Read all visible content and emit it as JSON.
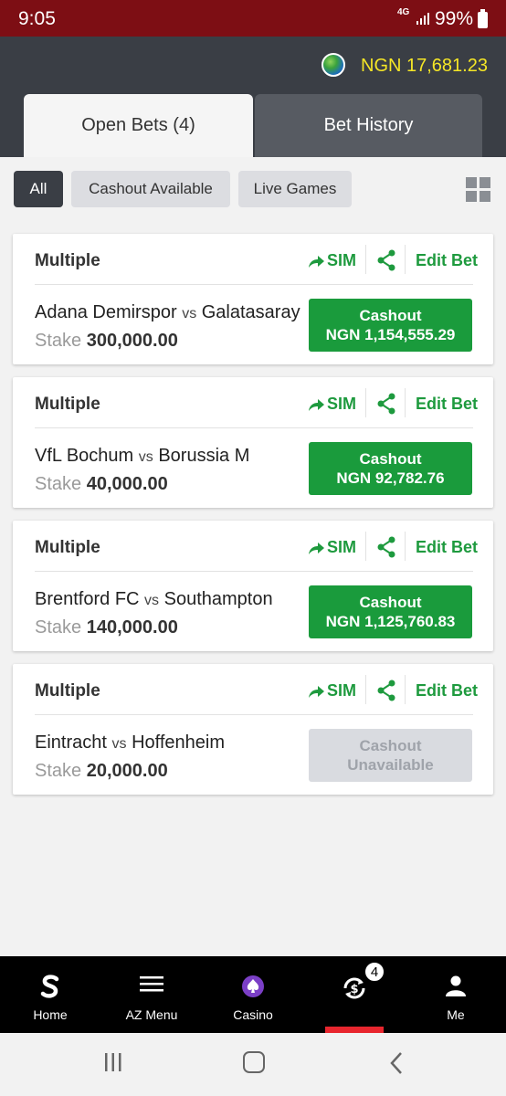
{
  "status_bar": {
    "time": "9:05",
    "network": "4G",
    "battery": "99%"
  },
  "header": {
    "balance": "NGN 17,681.23"
  },
  "tabs": [
    {
      "label": "Open Bets (4)",
      "active": true
    },
    {
      "label": "Bet History",
      "active": false
    }
  ],
  "filters": [
    {
      "label": "All",
      "active": true
    },
    {
      "label": "Cashout Available",
      "active": false
    },
    {
      "label": "Live Games",
      "active": false
    }
  ],
  "bets": [
    {
      "type": "Multiple",
      "sim_label": "SIM",
      "edit_label": "Edit Bet",
      "home": "Adana Demirspor",
      "vs": "vs",
      "away": "Galatasaray",
      "stake_label": "Stake",
      "stake": "300,000.00",
      "cashout_title": "Cashout",
      "cashout_value": "NGN  1,154,555.29",
      "available": true
    },
    {
      "type": "Multiple",
      "sim_label": "SIM",
      "edit_label": "Edit Bet",
      "home": "VfL Bochum",
      "vs": "vs",
      "away": "Borussia M",
      "stake_label": "Stake",
      "stake": "40,000.00",
      "cashout_title": "Cashout",
      "cashout_value": "NGN  92,782.76",
      "available": true
    },
    {
      "type": "Multiple",
      "sim_label": "SIM",
      "edit_label": "Edit Bet",
      "home": "Brentford FC",
      "vs": "vs",
      "away": "Southampton",
      "stake_label": "Stake",
      "stake": "140,000.00",
      "cashout_title": "Cashout",
      "cashout_value": "NGN  1,125,760.83",
      "available": true
    },
    {
      "type": "Multiple",
      "sim_label": "SIM",
      "edit_label": "Edit Bet",
      "home": "Eintracht",
      "vs": "vs",
      "away": "Hoffenheim",
      "stake_label": "Stake",
      "stake": "20,000.00",
      "cashout_title": "Cashout",
      "cashout_value": "Unavailable",
      "available": false
    }
  ],
  "bottom_nav": [
    {
      "label": "Home",
      "icon": "sportybet-logo-icon"
    },
    {
      "label": "AZ Menu",
      "icon": "menu-icon"
    },
    {
      "label": "Casino",
      "icon": "spade-icon"
    },
    {
      "label": "",
      "icon": "cashout-bets-icon",
      "badge": "4",
      "active": true
    },
    {
      "label": "Me",
      "icon": "user-icon"
    }
  ],
  "colors": {
    "accent_green": "#1a9b3c",
    "header": "#3a3e45",
    "status_bar": "#7d0e14",
    "balance": "#f5e626",
    "active_nav": "#e8262e"
  }
}
